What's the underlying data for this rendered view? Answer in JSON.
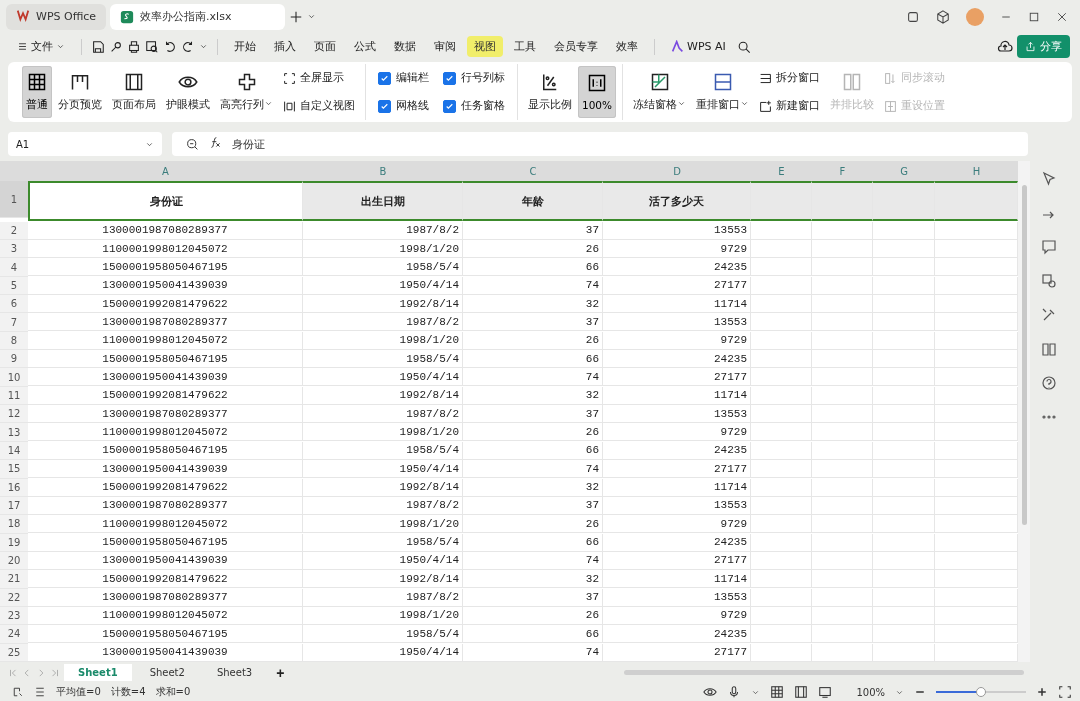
{
  "window_tabs": [
    {
      "label": "WPS Office",
      "selected": false
    },
    {
      "label": "效率办公指南.xlsx",
      "selected": true
    }
  ],
  "menu": {
    "file": "文件",
    "tabs": [
      {
        "label": "开始",
        "selected": false
      },
      {
        "label": "插入",
        "selected": false
      },
      {
        "label": "页面",
        "selected": false
      },
      {
        "label": "公式",
        "selected": false
      },
      {
        "label": "数据",
        "selected": false
      },
      {
        "label": "审阅",
        "selected": false
      },
      {
        "label": "视图",
        "selected": true
      },
      {
        "label": "工具",
        "selected": false
      },
      {
        "label": "会员专享",
        "selected": false
      },
      {
        "label": "效率",
        "selected": false
      }
    ],
    "ai": "WPS AI",
    "share": "分享"
  },
  "ribbon": {
    "groups": [
      {
        "items": [
          {
            "kind": "large",
            "label": "普通",
            "selected": true,
            "dropdown": false,
            "disabled": false
          },
          {
            "kind": "large",
            "label": "分页预览",
            "selected": false,
            "dropdown": false,
            "disabled": false
          },
          {
            "kind": "large",
            "label": "页面布局",
            "selected": false,
            "dropdown": false,
            "disabled": false
          },
          {
            "kind": "large",
            "label": "护眼模式",
            "selected": false,
            "dropdown": false,
            "disabled": false
          },
          {
            "kind": "large",
            "label": "高亮行列",
            "selected": false,
            "dropdown": true,
            "disabled": false
          },
          {
            "kind": "small",
            "label": "全屏显示",
            "disabled": false
          },
          {
            "kind": "small",
            "label": "自定义视图",
            "disabled": false
          }
        ]
      },
      {
        "items": [
          {
            "kind": "check",
            "label": "编辑栏",
            "checked": true
          },
          {
            "kind": "check",
            "label": "网格线",
            "checked": true
          },
          {
            "kind": "check",
            "label": "行号列标",
            "checked": true
          },
          {
            "kind": "check",
            "label": "任务窗格",
            "checked": true
          }
        ]
      },
      {
        "items": [
          {
            "kind": "large",
            "label": "显示比例",
            "selected": false,
            "dropdown": false,
            "disabled": false
          },
          {
            "kind": "large",
            "label": "100%",
            "selected": true,
            "dropdown": false,
            "disabled": false
          }
        ]
      },
      {
        "items": [
          {
            "kind": "large",
            "label": "冻结窗格",
            "selected": false,
            "dropdown": true,
            "disabled": false
          },
          {
            "kind": "large",
            "label": "重排窗口",
            "selected": false,
            "dropdown": true,
            "disabled": false
          },
          {
            "kind": "small",
            "label": "拆分窗口",
            "disabled": false
          },
          {
            "kind": "small",
            "label": "新建窗口",
            "disabled": false
          },
          {
            "kind": "large",
            "label": "并排比较",
            "selected": false,
            "dropdown": false,
            "disabled": true
          },
          {
            "kind": "small",
            "label": "同步滚动",
            "disabled": true
          },
          {
            "kind": "small",
            "label": "重设位置",
            "disabled": true
          }
        ]
      }
    ]
  },
  "formula_bar": {
    "cell_ref": "A1",
    "value": "身份证"
  },
  "sheet": {
    "columns": [
      "A",
      "B",
      "C",
      "D",
      "E",
      "F",
      "G",
      "H"
    ],
    "header_row": {
      "num": "1",
      "selected": true,
      "cells": [
        "身份证",
        "出生日期",
        "年龄",
        "活了多少天"
      ]
    },
    "rows": [
      {
        "num": "2",
        "selected": false,
        "cells": [
          "1300001987080289377",
          "1987/8/2",
          "37",
          "13553"
        ]
      },
      {
        "num": "3",
        "selected": false,
        "cells": [
          "1100001998012045072",
          "1998/1/20",
          "26",
          "9729"
        ]
      },
      {
        "num": "4",
        "selected": false,
        "cells": [
          "1500001958050467195",
          "1958/5/4",
          "66",
          "24235"
        ]
      },
      {
        "num": "5",
        "selected": false,
        "cells": [
          "1300001950041439039",
          "1950/4/14",
          "74",
          "27177"
        ]
      },
      {
        "num": "6",
        "selected": false,
        "cells": [
          "1500001992081479622",
          "1992/8/14",
          "32",
          "11714"
        ]
      },
      {
        "num": "7",
        "selected": false,
        "cells": [
          "1300001987080289377",
          "1987/8/2",
          "37",
          "13553"
        ]
      },
      {
        "num": "8",
        "selected": false,
        "cells": [
          "1100001998012045072",
          "1998/1/20",
          "26",
          "9729"
        ]
      },
      {
        "num": "9",
        "selected": false,
        "cells": [
          "1500001958050467195",
          "1958/5/4",
          "66",
          "24235"
        ]
      },
      {
        "num": "10",
        "selected": false,
        "cells": [
          "1300001950041439039",
          "1950/4/14",
          "74",
          "27177"
        ]
      },
      {
        "num": "11",
        "selected": false,
        "cells": [
          "1500001992081479622",
          "1992/8/14",
          "32",
          "11714"
        ]
      },
      {
        "num": "12",
        "selected": false,
        "cells": [
          "1300001987080289377",
          "1987/8/2",
          "37",
          "13553"
        ]
      },
      {
        "num": "13",
        "selected": false,
        "cells": [
          "1100001998012045072",
          "1998/1/20",
          "26",
          "9729"
        ]
      },
      {
        "num": "14",
        "selected": false,
        "cells": [
          "1500001958050467195",
          "1958/5/4",
          "66",
          "24235"
        ]
      },
      {
        "num": "15",
        "selected": false,
        "cells": [
          "1300001950041439039",
          "1950/4/14",
          "74",
          "27177"
        ]
      },
      {
        "num": "16",
        "selected": false,
        "cells": [
          "1500001992081479622",
          "1992/8/14",
          "32",
          "11714"
        ]
      },
      {
        "num": "17",
        "selected": false,
        "cells": [
          "1300001987080289377",
          "1987/8/2",
          "37",
          "13553"
        ]
      },
      {
        "num": "18",
        "selected": false,
        "cells": [
          "1100001998012045072",
          "1998/1/20",
          "26",
          "9729"
        ]
      },
      {
        "num": "19",
        "selected": false,
        "cells": [
          "1500001958050467195",
          "1958/5/4",
          "66",
          "24235"
        ]
      },
      {
        "num": "20",
        "selected": false,
        "cells": [
          "1300001950041439039",
          "1950/4/14",
          "74",
          "27177"
        ]
      },
      {
        "num": "21",
        "selected": false,
        "cells": [
          "1500001992081479622",
          "1992/8/14",
          "32",
          "11714"
        ]
      },
      {
        "num": "22",
        "selected": false,
        "cells": [
          "1300001987080289377",
          "1987/8/2",
          "37",
          "13553"
        ]
      },
      {
        "num": "23",
        "selected": false,
        "cells": [
          "1100001998012045072",
          "1998/1/20",
          "26",
          "9729"
        ]
      },
      {
        "num": "24",
        "selected": false,
        "cells": [
          "1500001958050467195",
          "1958/5/4",
          "66",
          "24235"
        ]
      },
      {
        "num": "25",
        "selected": false,
        "cells": [
          "1300001950041439039",
          "1950/4/14",
          "74",
          "27177"
        ]
      }
    ]
  },
  "sheet_tabs": [
    {
      "label": "Sheet1",
      "selected": true
    },
    {
      "label": "Sheet2",
      "selected": false
    },
    {
      "label": "Sheet3",
      "selected": false
    }
  ],
  "add_sheet": "+",
  "status_bar": {
    "stats": [
      "平均值=0",
      "计数=4",
      "求和=0"
    ],
    "zoom": "100%",
    "zoom_slider": {
      "level": 0.5
    }
  }
}
